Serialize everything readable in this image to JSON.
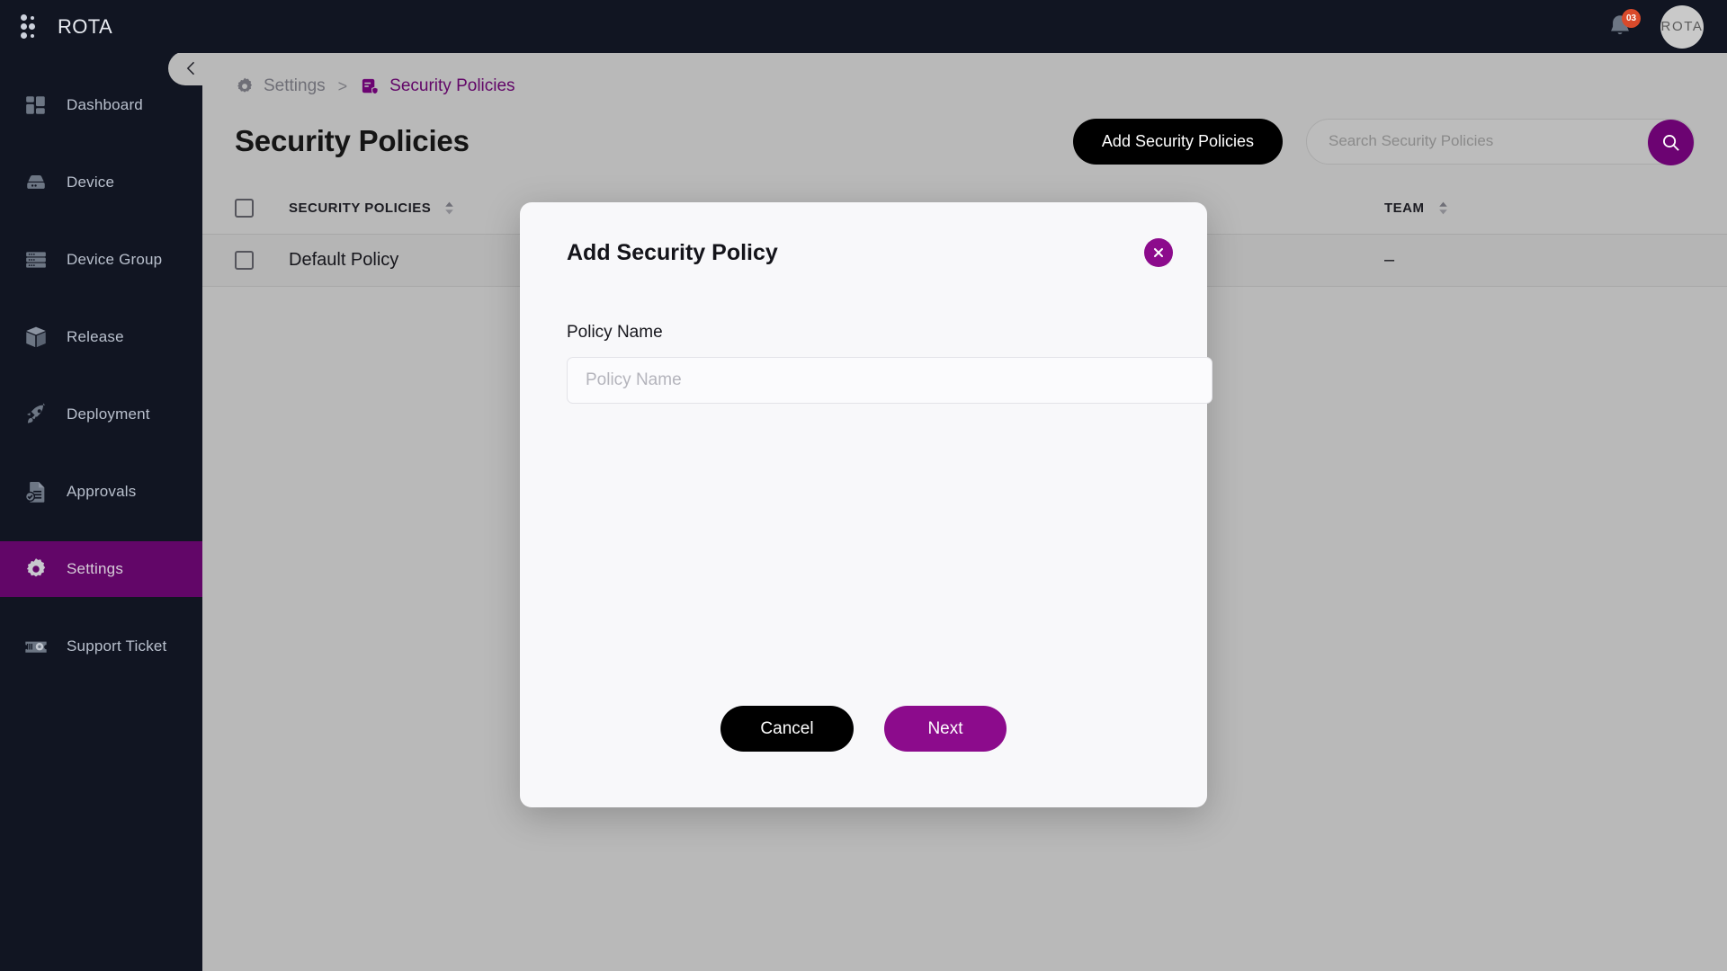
{
  "app": {
    "brand_name": "ROTA",
    "logo_icon": "dot-grid-icon"
  },
  "topbar": {
    "notification_icon": "bell-icon",
    "notification_count": "03",
    "avatar_initials": "ROTA"
  },
  "sidebar": {
    "collapse_icon": "chevron-left-icon",
    "items": [
      {
        "label": "Dashboard",
        "icon": "dashboard-grid-icon",
        "active": false
      },
      {
        "label": "Device",
        "icon": "device-disk-icon",
        "active": false
      },
      {
        "label": "Device Group",
        "icon": "server-rack-icon",
        "active": false
      },
      {
        "label": "Release",
        "icon": "package-box-icon",
        "active": false
      },
      {
        "label": "Deployment",
        "icon": "rocket-icon",
        "active": false
      },
      {
        "label": "Approvals",
        "icon": "document-check-icon",
        "active": false
      },
      {
        "label": "Settings",
        "icon": "gear-icon",
        "active": true
      },
      {
        "label": "Support Ticket",
        "icon": "ticket-gear-icon",
        "active": false
      }
    ]
  },
  "breadcrumb": {
    "items": [
      {
        "label": "Settings",
        "icon": "gear-icon",
        "current": false
      },
      {
        "label": "Security Policies",
        "icon": "policy-shield-icon",
        "current": true
      }
    ],
    "separator": ">"
  },
  "page": {
    "title": "Security Policies",
    "add_button_label": "Add Security Policies",
    "search_placeholder": "Search Security Policies",
    "search_value": "",
    "search_icon": "search-icon"
  },
  "table": {
    "columns": [
      {
        "label": "SECURITY POLICIES",
        "sortable": true
      },
      {
        "label": "TEAM",
        "sortable": true
      }
    ],
    "rows": [
      {
        "policy": "Default Policy",
        "team": "–",
        "selected": false
      }
    ]
  },
  "modal": {
    "title": "Add Security Policy",
    "close_icon": "close-x-icon",
    "field_label": "Policy Name",
    "field_placeholder": "Policy Name",
    "field_value": "",
    "cancel_label": "Cancel",
    "next_label": "Next"
  },
  "colors": {
    "sidebar_bg": "#111522",
    "accent_purple": "#6c0372",
    "button_purple": "#8c0b8c",
    "page_bg": "#b9b9b9",
    "badge_orange": "#d94a2b"
  }
}
